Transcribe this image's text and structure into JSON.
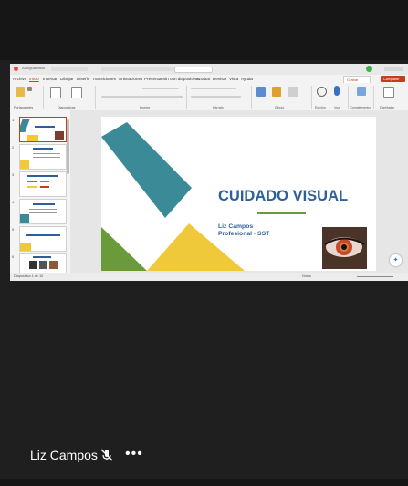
{
  "slide": {
    "title": "CUIDADO VISUAL",
    "author_line1": "Liz Campos",
    "author_line2": "Profesional - SST"
  },
  "ribbon_tabs": [
    "Archivo",
    "Inicio",
    "Insertar",
    "Dibujar",
    "Diseño",
    "Transiciones",
    "Animaciones",
    "Presentación con diapositivas",
    "Grabar",
    "Revisar",
    "Vista",
    "Ayuda"
  ],
  "ribbon_groups": [
    "Portapapeles",
    "Diapositivas",
    "Fuente",
    "Párrafo",
    "Dibujo",
    "Edición",
    "Voz",
    "Complementos",
    "Diseñador"
  ],
  "titlebar": {
    "autosave": "Autoguardado",
    "record": "Grabar",
    "share": "Compartir"
  },
  "status": {
    "slide_info": "Diapositiva 1 de 10",
    "notes": "Notas"
  },
  "participant": {
    "name": "Liz Campos",
    "more": "•••"
  },
  "colors": {
    "accent": "#c43e1c",
    "slide_title": "#2d5f9a",
    "teal": "#3a8a98",
    "yellow": "#f0c93a",
    "green": "#6a9a3a"
  },
  "icons": [
    "microphone-muted-icon",
    "more-options-icon",
    "copilot-icon",
    "close-icon"
  ]
}
